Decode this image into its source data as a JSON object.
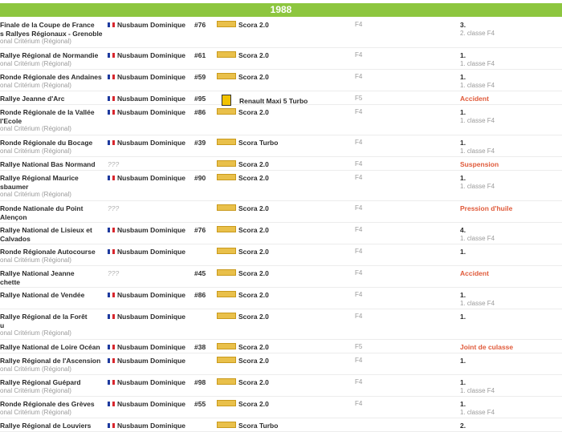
{
  "season": {
    "year": "1988"
  },
  "columns_note": "",
  "results": [
    {
      "event": "Finale de la Coupe de France des Rallyes Régionaux - Grenoble",
      "event_lines": [
        "Finale de la Coupe de France",
        "s Rallyes Régionaux - Grenoble"
      ],
      "event_sub": "onal Critérium (Régional)",
      "driver": "Nusbaum Dominique",
      "number": "#76",
      "car": "Scora 2.0",
      "car_logo": "scora-logo",
      "class": "F4",
      "result": "3.",
      "result_sub": "2. classe F4",
      "status": "finished"
    },
    {
      "event_lines": [
        "Rallye Régional de Normandie"
      ],
      "event_sub": "onal Critérium (Régional)",
      "driver": "Nusbaum Dominique",
      "number": "#61",
      "car": "Scora 2.0",
      "car_logo": "scora-logo",
      "class": "F4",
      "result": "1.",
      "result_sub": "1. classe F4",
      "status": "finished"
    },
    {
      "event_lines": [
        "Ronde Régionale des Andaines"
      ],
      "event_sub": "onal Critérium (Régional)",
      "driver": "Nusbaum Dominique",
      "number": "#59",
      "car": "Scora 2.0",
      "car_logo": "scora-logo",
      "class": "F4",
      "result": "1.",
      "result_sub": "1. classe F4",
      "status": "finished"
    },
    {
      "event_lines": [
        "Rallye Jeanne d'Arc"
      ],
      "event_sub": "",
      "driver": "Nusbaum Dominique",
      "number": "#95",
      "car": "Renault Maxi 5 Turbo",
      "car_logo": "renault-logo",
      "class": "F5",
      "result": "Accident",
      "result_sub": "",
      "status": "fail"
    },
    {
      "event_lines": [
        "Ronde Régionale de la Vallée",
        "l'Ecole"
      ],
      "event_sub": "onal Critérium (Régional)",
      "driver": "Nusbaum Dominique",
      "number": "#86",
      "car": "Scora 2.0",
      "car_logo": "scora-logo",
      "class": "F4",
      "result": "1.",
      "result_sub": "1. classe F4",
      "status": "finished"
    },
    {
      "event_lines": [
        "Ronde Régionale du Bocage"
      ],
      "event_sub": "onal Critérium (Régional)",
      "driver": "Nusbaum Dominique",
      "number": "#39",
      "car": "Scora Turbo",
      "car_logo": "scora-logo",
      "class": "F4",
      "result": "1.",
      "result_sub": "1. classe F4",
      "status": "finished"
    },
    {
      "event_lines": [
        "Rallye National Bas Normand"
      ],
      "event_sub": "",
      "driver": "???",
      "number": "",
      "car": "Scora 2.0",
      "car_logo": "scora-logo",
      "class": "F4",
      "result": "Suspension",
      "result_sub": "",
      "status": "fail"
    },
    {
      "event_lines": [
        "Rallye Régional Maurice",
        "sbaumer"
      ],
      "event_sub": "onal Critérium (Régional)",
      "driver": "Nusbaum Dominique",
      "number": "#90",
      "car": "Scora 2.0",
      "car_logo": "scora-logo",
      "class": "F4",
      "result": "1.",
      "result_sub": "1. classe F4",
      "status": "finished"
    },
    {
      "event_lines": [
        "Ronde Nationale du Point",
        "Alençon"
      ],
      "event_sub": "",
      "driver": "???",
      "number": "",
      "car": "Scora 2.0",
      "car_logo": "scora-logo",
      "class": "F4",
      "result": "Pression d'huile",
      "result_sub": "",
      "status": "fail"
    },
    {
      "event_lines": [
        "Rallye National de Lisieux et",
        "Calvados"
      ],
      "event_sub": "",
      "driver": "Nusbaum Dominique",
      "number": "#76",
      "car": "Scora 2.0",
      "car_logo": "scora-logo",
      "class": "F4",
      "result": "4.",
      "result_sub": "1. classe F4",
      "status": "finished"
    },
    {
      "event_lines": [
        "Ronde Régionale Autocourse"
      ],
      "event_sub": "onal Critérium (Régional)",
      "driver": "Nusbaum Dominique",
      "number": "",
      "car": "Scora 2.0",
      "car_logo": "scora-logo",
      "class": "F4",
      "result": "1.",
      "result_sub": "",
      "status": "finished"
    },
    {
      "event_lines": [
        "Rallye National Jeanne",
        "chette"
      ],
      "event_sub": "",
      "driver": "???",
      "number": "#45",
      "car": "Scora 2.0",
      "car_logo": "scora-logo",
      "class": "F4",
      "result": "Accident",
      "result_sub": "",
      "status": "fail"
    },
    {
      "event_lines": [
        "Rallye National de Vendée"
      ],
      "event_sub": "",
      "driver": "Nusbaum Dominique",
      "number": "#86",
      "car": "Scora 2.0",
      "car_logo": "scora-logo",
      "class": "F4",
      "result": "1.",
      "result_sub": "1. classe F4",
      "status": "finished"
    },
    {
      "event_lines": [
        "Rallye Régional de la Forêt",
        "u"
      ],
      "event_sub": "onal Critérium (Régional)",
      "driver": "Nusbaum Dominique",
      "number": "",
      "car": "Scora 2.0",
      "car_logo": "scora-logo",
      "class": "F4",
      "result": "1.",
      "result_sub": "",
      "status": "finished"
    },
    {
      "event_lines": [
        "Rallye National de Loire Océan"
      ],
      "event_sub": "",
      "driver": "Nusbaum Dominique",
      "number": "#38",
      "car": "Scora 2.0",
      "car_logo": "scora-logo",
      "class": "F5",
      "result": "Joint de culasse",
      "result_sub": "",
      "status": "fail"
    },
    {
      "event_lines": [
        "Rallye Régional de l'Ascension"
      ],
      "event_sub": "onal Critérium (Régional)",
      "driver": "Nusbaum Dominique",
      "number": "",
      "car": "Scora 2.0",
      "car_logo": "scora-logo",
      "class": "F4",
      "result": "1.",
      "result_sub": "",
      "status": "finished"
    },
    {
      "event_lines": [
        "Rallye Régional Guépard"
      ],
      "event_sub": "onal Critérium (Régional)",
      "driver": "Nusbaum Dominique",
      "number": "#98",
      "car": "Scora 2.0",
      "car_logo": "scora-logo",
      "class": "F4",
      "result": "1.",
      "result_sub": "1. classe F4",
      "status": "finished"
    },
    {
      "event_lines": [
        "Ronde Régionale des Grèves"
      ],
      "event_sub": "onal Critérium (Régional)",
      "driver": "Nusbaum Dominique",
      "number": "#55",
      "car": "Scora 2.0",
      "car_logo": "scora-logo",
      "class": "F4",
      "result": "1.",
      "result_sub": "1. classe F4",
      "status": "finished"
    },
    {
      "event_lines": [
        "Rallye Régional de Louviers"
      ],
      "event_sub": "",
      "driver": "Nusbaum Dominique",
      "number": "",
      "car": "Scora Turbo",
      "car_logo": "scora-logo",
      "class": "",
      "result": "2.",
      "result_sub": "",
      "status": "finished"
    }
  ]
}
